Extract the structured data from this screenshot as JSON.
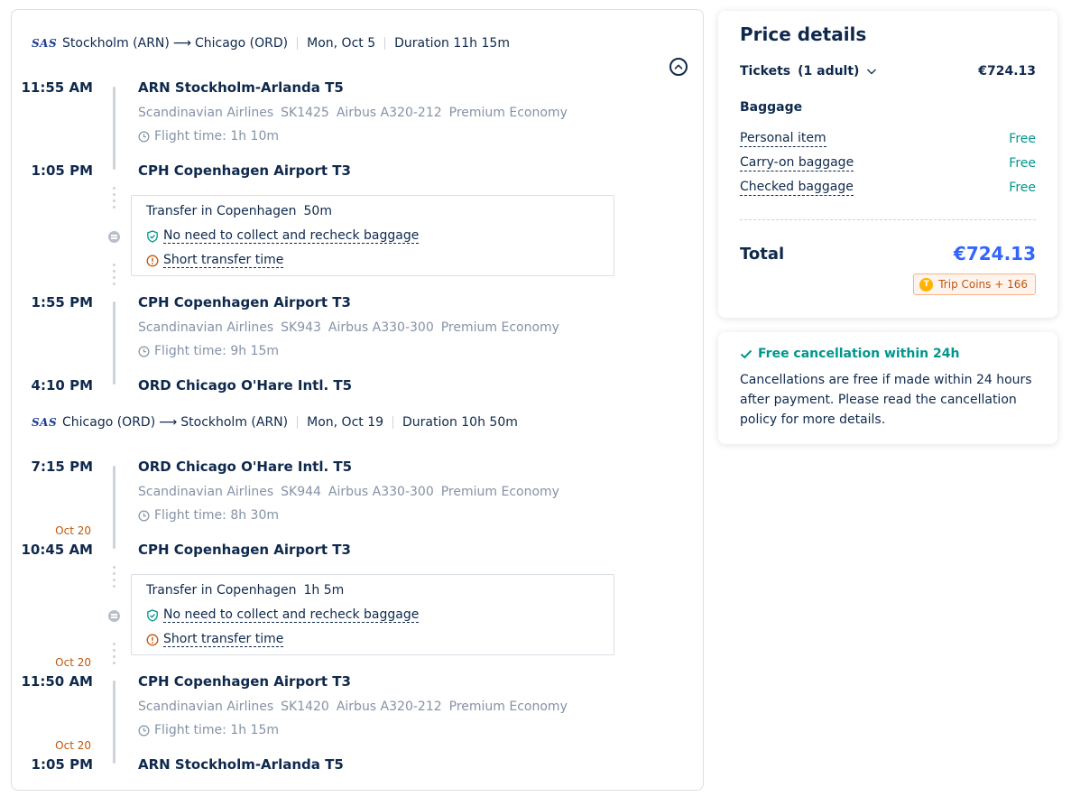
{
  "itinerary": {
    "collapse_icon": "chevron-up-circle-icon",
    "outbound": {
      "airline_logo": "SAS",
      "origin": "Stockholm (ARN)",
      "destination": "Chicago (ORD)",
      "date": "Mon, Oct 5",
      "duration": "Duration 11h 15m",
      "segments": [
        {
          "dep_time": "11:55 AM",
          "dep_airport": "ARN Stockholm-Arlanda T5",
          "airline": "Scandinavian Airlines",
          "flight_no": "SK1425",
          "aircraft": "Airbus A320-212",
          "cabin": "Premium Economy",
          "flight_time": "Flight time: 1h 10m",
          "arr_time": "1:05 PM",
          "arr_airport": "CPH Copenhagen Airport T3"
        },
        {
          "dep_time": "1:55 PM",
          "dep_airport": "CPH Copenhagen Airport T3",
          "airline": "Scandinavian Airlines",
          "flight_no": "SK943",
          "aircraft": "Airbus A330-300",
          "cabin": "Premium Economy",
          "flight_time": "Flight time: 9h 15m",
          "arr_time": "4:10 PM",
          "arr_airport": "ORD Chicago O'Hare Intl. T5"
        }
      ],
      "transfer": {
        "title": "Transfer in Copenhagen",
        "duration": "50m",
        "baggage_note": "No need to collect and recheck baggage",
        "warning": "Short transfer time"
      }
    },
    "return": {
      "airline_logo": "SAS",
      "origin": "Chicago (ORD)",
      "destination": "Stockholm (ARN)",
      "date": "Mon, Oct 19",
      "duration": "Duration 10h 50m",
      "segments": [
        {
          "dep_time": "7:15 PM",
          "dep_airport": "ORD Chicago O'Hare Intl. T5",
          "airline": "Scandinavian Airlines",
          "flight_no": "SK944",
          "aircraft": "Airbus A330-300",
          "cabin": "Premium Economy",
          "flight_time": "Flight time: 8h 30m",
          "arr_date": "Oct 20",
          "arr_time": "10:45 AM",
          "arr_airport": "CPH Copenhagen Airport T3"
        },
        {
          "dep_date": "Oct 20",
          "dep_time": "11:50 AM",
          "dep_airport": "CPH Copenhagen Airport T3",
          "airline": "Scandinavian Airlines",
          "flight_no": "SK1420",
          "aircraft": "Airbus A320-212",
          "cabin": "Premium Economy",
          "flight_time": "Flight time: 1h 15m",
          "arr_date": "Oct 20",
          "arr_time": "1:05 PM",
          "arr_airport": "ARN Stockholm-Arlanda T5"
        }
      ],
      "transfer": {
        "title": "Transfer in Copenhagen",
        "duration": "1h 5m",
        "baggage_note": "No need to collect and recheck baggage",
        "warning": "Short transfer time"
      }
    }
  },
  "price": {
    "title": "Price details",
    "tickets_label": "Tickets",
    "tickets_qty": "(1 adult)",
    "tickets_amount": "€724.13",
    "baggage_title": "Baggage",
    "baggage": [
      {
        "label": "Personal item",
        "value": "Free"
      },
      {
        "label": "Carry-on baggage",
        "value": "Free"
      },
      {
        "label": "Checked baggage",
        "value": "Free"
      }
    ],
    "total_label": "Total",
    "total_amount": "€724.13",
    "coins_icon": "T",
    "coins_text": "Trip Coins + 166"
  },
  "cancellation": {
    "title": "Free cancellation within 24h",
    "text": "Cancellations are free if made within 24 hours after payment. Please read the cancellation policy for more details."
  },
  "colors": {
    "text": "#0f294d",
    "muted": "#8592a6",
    "accent_blue": "#3264ff",
    "teal": "#00968d",
    "orange": "#c1560b",
    "brand_sas": "#1b3d95"
  }
}
